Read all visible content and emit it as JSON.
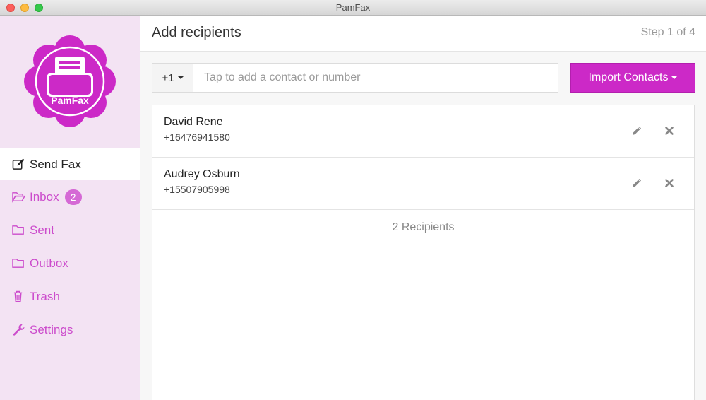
{
  "window": {
    "title": "PamFax"
  },
  "logo": {
    "text": "PamFax",
    "color": "#cc29c7"
  },
  "sidebar": {
    "items": [
      {
        "label": "Send Fax",
        "icon": "edit-icon",
        "active": true
      },
      {
        "label": "Inbox",
        "icon": "folder-open-icon",
        "badge": "2"
      },
      {
        "label": "Sent",
        "icon": "folder-icon"
      },
      {
        "label": "Outbox",
        "icon": "folder-icon"
      },
      {
        "label": "Trash",
        "icon": "trash-icon"
      },
      {
        "label": "Settings",
        "icon": "wrench-icon"
      }
    ]
  },
  "header": {
    "title": "Add recipients",
    "step": "Step 1 of 4"
  },
  "search": {
    "country_code": "+1",
    "placeholder": "Tap to add a contact or number"
  },
  "import_button": {
    "label": "Import Contacts"
  },
  "recipients": [
    {
      "name": "David Rene",
      "number": "+16476941580"
    },
    {
      "name": "Audrey Osburn",
      "number": "+15507905998"
    }
  ],
  "recipients_count": "2 Recipients",
  "colors": {
    "accent": "#cc29c7",
    "sidebar_bg": "#f3e3f3",
    "nav_text": "#cc4ccc"
  }
}
